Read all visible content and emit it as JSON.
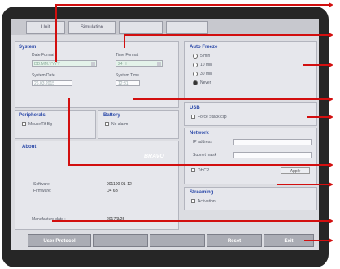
{
  "tabs": [
    {
      "label": "Unit"
    },
    {
      "label": "Simulation"
    },
    {
      "label": ""
    },
    {
      "label": ""
    }
  ],
  "system": {
    "title": "System",
    "date_format_label": "Date Format",
    "date_format_value": "DD.MM.YYYY",
    "time_format_label": "Time Format",
    "time_format_value": "24 H",
    "system_date_label": "System Date",
    "system_date_value": "26.03.2015",
    "system_time_label": "System Time",
    "system_time_value": "12:31"
  },
  "peripherals": {
    "title": "Peripherals",
    "option": "Mouse/Rf Bg"
  },
  "battery": {
    "title": "Battery",
    "option": "No alarm"
  },
  "about": {
    "title": "About",
    "logo_text": "BRAVO",
    "software_label": "Software:",
    "software_value": "901100-01-12",
    "firmware_label": "Firmware:",
    "firmware_value": "D4 6B",
    "manufacture_label": "Manufacture date :",
    "manufacture_value": "2017/3/25"
  },
  "auto_freeze": {
    "title": "Auto Freeze",
    "options": [
      {
        "label": "5 min"
      },
      {
        "label": "10 min"
      },
      {
        "label": "30 min"
      },
      {
        "label": "Never"
      }
    ],
    "selected": "Never"
  },
  "usb": {
    "title": "USB",
    "option": "Force Stack clip"
  },
  "network": {
    "title": "Network",
    "ip_label": "IP address",
    "subnet_label": "Subnet mask",
    "dhcp_label": "DHCP",
    "apply_label": "Apply"
  },
  "streaming": {
    "title": "Streaming",
    "option": "Activation"
  },
  "bottom_buttons": [
    {
      "label": "User Protocol"
    },
    {
      "label": ""
    },
    {
      "label": ""
    },
    {
      "label": "Reset"
    },
    {
      "label": "Exit"
    }
  ],
  "colors": {
    "callout": "#d20f0f",
    "bezel": "#262626",
    "title_blue": "#2a48a8"
  }
}
